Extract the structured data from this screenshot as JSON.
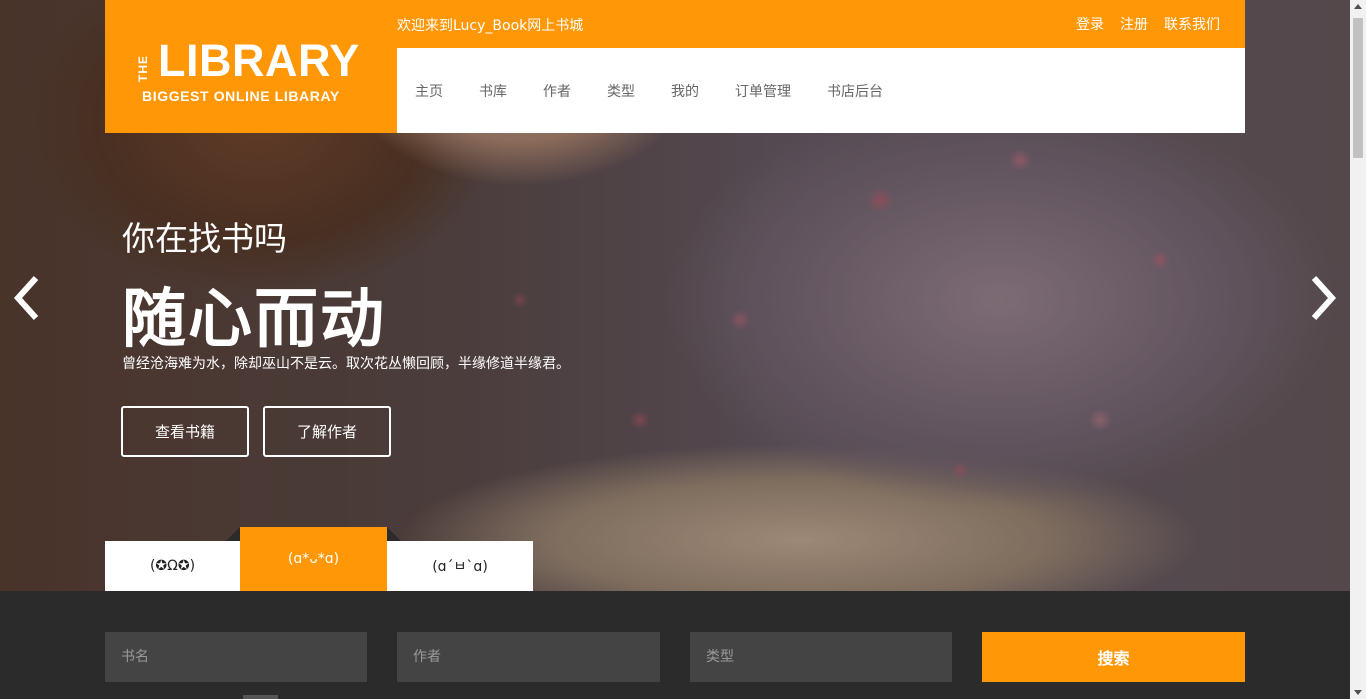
{
  "brand": {
    "the": "THE",
    "name": "LIBRARY",
    "tagline": "BIGGEST ONLINE LIBARAY",
    "accent": "#ff9707"
  },
  "topbar": {
    "welcome": "欢迎来到Lucy_Book网上书城",
    "links": [
      "登录",
      "注册",
      "联系我们"
    ]
  },
  "nav": [
    "主页",
    "书库",
    "作者",
    "类型",
    "我的",
    "订单管理",
    "书店后台"
  ],
  "hero": {
    "subtitle": "你在找书吗",
    "title": "随心而动",
    "description": "曾经沧海难为水，除却巫山不是云。取次花丛懒回顾，半缘修道半缘君。",
    "buttons": [
      "查看书籍",
      "了解作者"
    ],
    "prev_icon": "chevron-left-icon",
    "next_icon": "chevron-right-icon"
  },
  "tabs": [
    {
      "label": "(✪Ω✪)",
      "active": false
    },
    {
      "label": "(ɑ*ᴗ*ɑ)",
      "active": true
    },
    {
      "label": "(ɑ´ㅂ`ɑ)",
      "active": false
    }
  ],
  "search": {
    "book_placeholder": "书名",
    "author_placeholder": "作者",
    "type_placeholder": "类型",
    "button": "搜索"
  }
}
